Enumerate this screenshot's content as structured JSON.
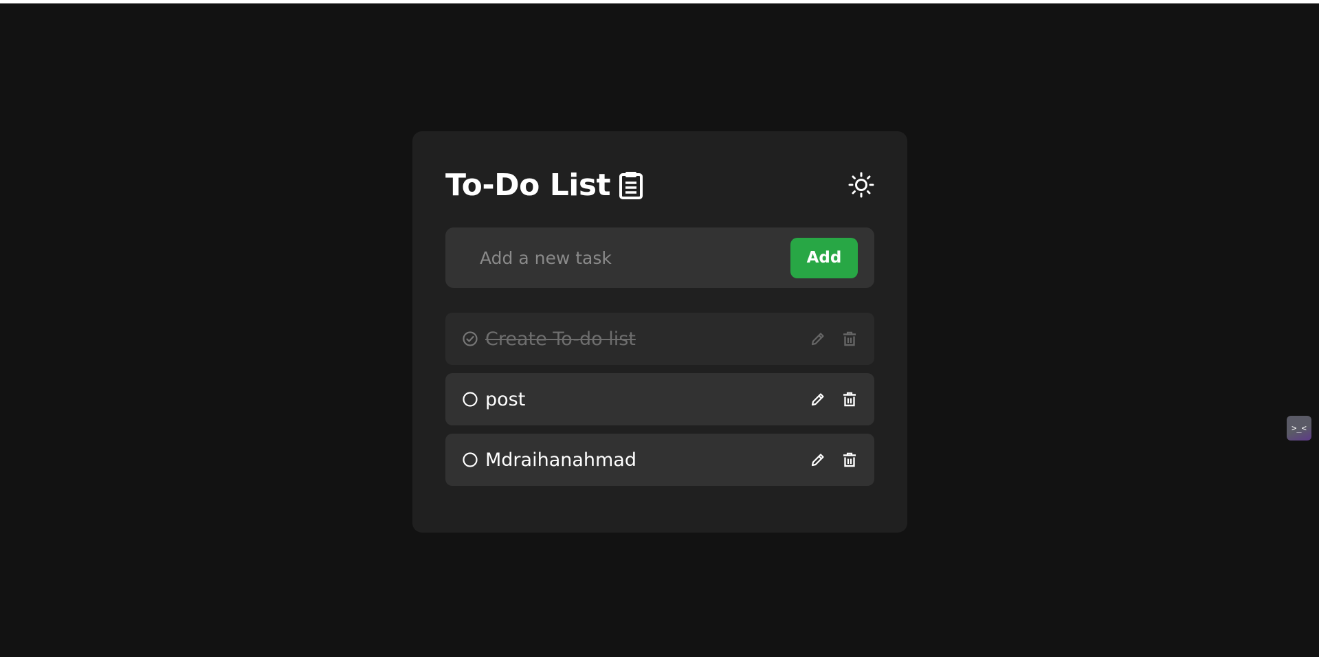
{
  "app": {
    "title": "To-Do List",
    "icons": {
      "title_icon": "clipboard-icon",
      "theme_toggle": "sun-icon"
    }
  },
  "new_task": {
    "placeholder": "Add a new task",
    "value": "",
    "add_label": "Add"
  },
  "tasks": [
    {
      "text": "Create To-do list",
      "completed": true
    },
    {
      "text": "post",
      "completed": false
    },
    {
      "text": "Mdraihanahmad",
      "completed": false
    }
  ],
  "widget": {
    "label": ">_<"
  },
  "colors": {
    "background": "#121212",
    "card": "#202020",
    "input": "#333333",
    "accent": "#28a745",
    "task": "#323232",
    "task_done": "#2a2a2a",
    "text": "#ffffff",
    "muted": "#6e6e6e"
  }
}
